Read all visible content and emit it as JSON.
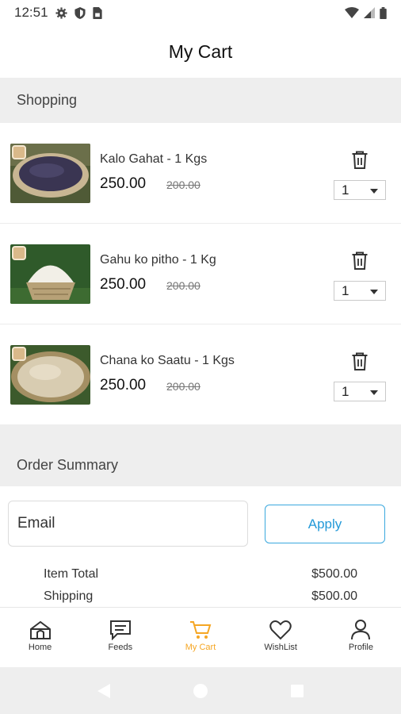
{
  "status_bar": {
    "time": "12:51",
    "left_icons": [
      "gear-icon",
      "shield-icon",
      "sim-card-icon"
    ],
    "right_icons": [
      "wifi-icon",
      "cell-signal-icon",
      "battery-icon"
    ]
  },
  "app_bar": {
    "title": "My Cart"
  },
  "shopping": {
    "header": "Shopping",
    "items": [
      {
        "name": "Kalo Gahat - 1 Kgs",
        "price": "250.00",
        "old_price": "200.00",
        "quantity": "1",
        "image": "black-lentils-basket-photo"
      },
      {
        "name": "Gahu ko pitho - 1 Kg",
        "price": "250.00",
        "old_price": "200.00",
        "quantity": "1",
        "image": "wheat-flour-basket-photo"
      },
      {
        "name": "Chana ko Saatu - 1 Kgs",
        "price": "250.00",
        "old_price": "200.00",
        "quantity": "1",
        "image": "chickpea-flour-basket-photo"
      }
    ]
  },
  "order_summary": {
    "header": "Order Summary",
    "email_placeholder": "Email",
    "apply_label": "Apply",
    "rows": [
      {
        "label": "Item Total",
        "value": "$500.00"
      },
      {
        "label": "Shipping",
        "value": "$500.00"
      }
    ]
  },
  "bottom_nav": {
    "items": [
      {
        "label": "Home",
        "icon": "home-icon"
      },
      {
        "label": "Feeds",
        "icon": "chat-icon"
      },
      {
        "label": "My Cart",
        "icon": "cart-icon",
        "active": true
      },
      {
        "label": "WishList",
        "icon": "heart-icon"
      },
      {
        "label": "Profile",
        "icon": "person-icon"
      }
    ],
    "active_color": "#f5a623"
  },
  "colors": {
    "accent": "#2399d8",
    "section_bg": "#eeeeee"
  }
}
